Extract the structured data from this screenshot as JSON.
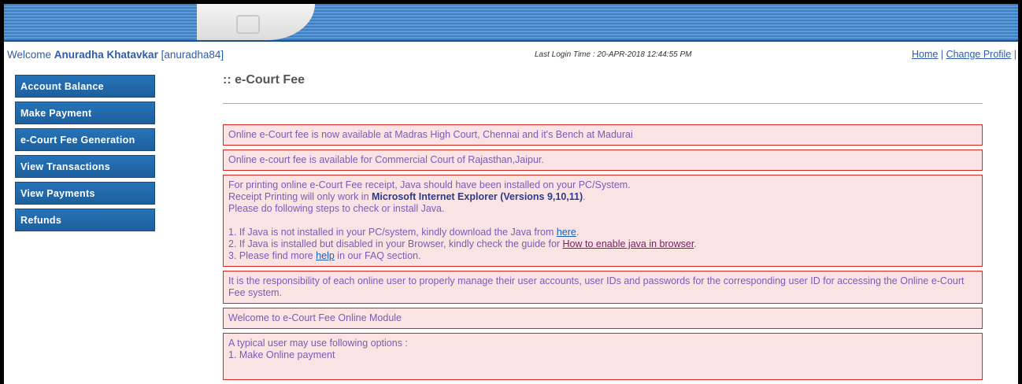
{
  "header": {
    "welcome_prefix": "Welcome ",
    "user_name": "Anuradha Khatavkar",
    "user_id": " [anuradha84]",
    "last_login": "Last Login Time : 20-APR-2018 12:44:55 PM",
    "links": {
      "home": "Home",
      "separator": " | ",
      "change_profile": "Change Profile",
      "trailing": " |"
    }
  },
  "sidebar": {
    "items": [
      {
        "label": "Account Balance"
      },
      {
        "label": "Make Payment"
      },
      {
        "label": "e-Court Fee Generation"
      },
      {
        "label": "View Transactions"
      },
      {
        "label": "View Payments"
      },
      {
        "label": "Refunds"
      }
    ]
  },
  "main": {
    "title": ":: e-Court Fee",
    "notices": {
      "n1": "Online e-Court fee is now available at Madras High Court, Chennai and it's Bench at Madurai",
      "n2": "Online e-court fee is available for Commercial Court of Rajasthan,Jaipur.",
      "n3": {
        "line1": "For printing online e-Court Fee receipt, Java should have been installed on your PC/System.",
        "line2_pre": "Receipt Printing will only work in ",
        "line2_bold": "Microsoft Internet Explorer (Versions 9,10,11)",
        "line2_post": ".",
        "line3": "Please do following steps to check or install Java.",
        "step1_pre": "1. If Java is not installed in your PC/system, kindly download the Java from ",
        "step1_link": "here",
        "step1_post": ".",
        "step2_pre": "2. If Java is installed but disabled in your Browser, kindly check the guide for ",
        "step2_link": "How to enable java in browser",
        "step2_post": ".",
        "step3_pre": "3. Please find more ",
        "step3_link": "help",
        "step3_post": " in our FAQ section."
      },
      "n4": "It is the responsibility of each online user to properly manage their user accounts, user IDs and passwords for the corresponding user ID for accessing the Online e-Court Fee system.",
      "n5": "Welcome to e-Court Fee Online Module",
      "n6": {
        "line1": "A typical user may use following options :",
        "line2": "1. Make Online payment"
      }
    }
  }
}
